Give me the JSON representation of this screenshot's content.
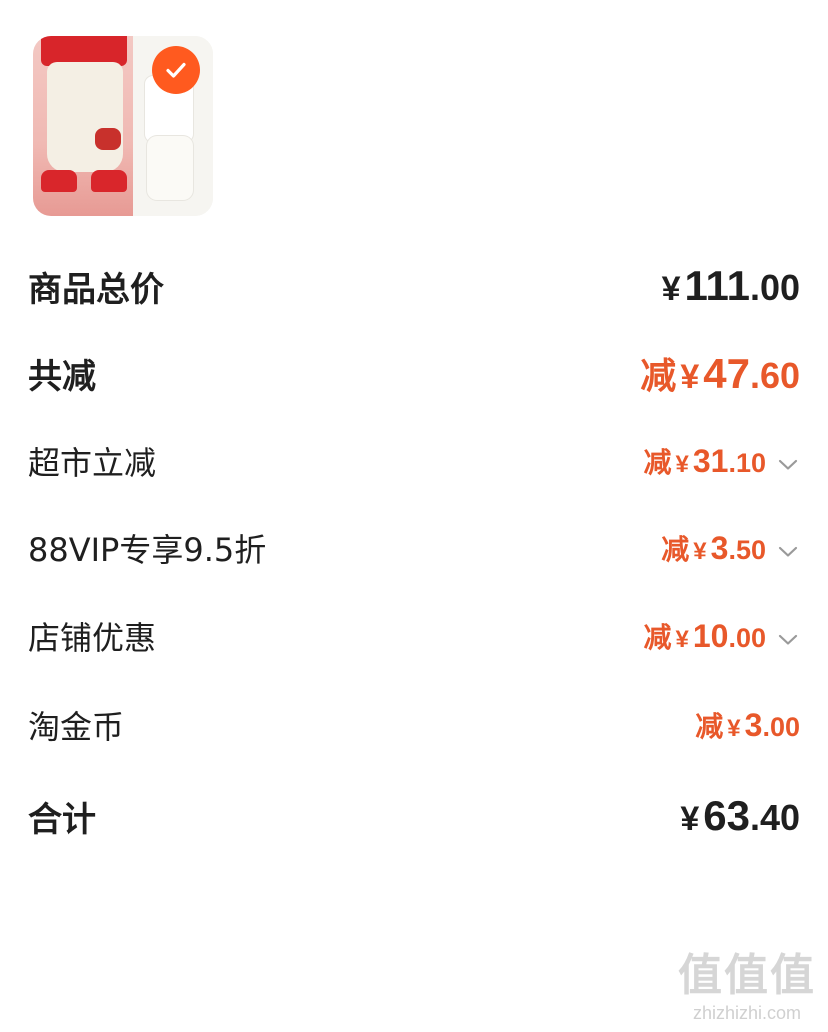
{
  "product": {
    "image_icon": "product-thumbnail",
    "selected_icon": "checkmark-icon",
    "accent_color": "#ff5a1f"
  },
  "rows": {
    "subtotal": {
      "label": "商品总价",
      "currency": "¥",
      "int": "111",
      "dec": ".00"
    },
    "total_discount": {
      "label": "共减",
      "prefix": "减",
      "currency": "¥",
      "int": "47",
      "dec": ".60"
    },
    "supermarket": {
      "label": "超市立减",
      "prefix": "减",
      "currency": "¥",
      "int": "31",
      "dec": ".10"
    },
    "vip": {
      "label": "88VIP专享9.5折",
      "prefix": "减",
      "currency": "¥",
      "int": "3",
      "dec": ".50"
    },
    "store": {
      "label": "店铺优惠",
      "prefix": "减",
      "currency": "¥",
      "int": "10",
      "dec": ".00"
    },
    "coins": {
      "label": "淘金币",
      "prefix": "减",
      "currency": "¥",
      "int": "3",
      "dec": ".00"
    },
    "total": {
      "label": "合计",
      "currency": "¥",
      "int": "63",
      "dec": ".40"
    }
  },
  "colors": {
    "discount": "#e8582a",
    "text": "#1f1f1f"
  },
  "watermark": {
    "text": "值值值",
    "url": "zhizhizhi.com"
  }
}
